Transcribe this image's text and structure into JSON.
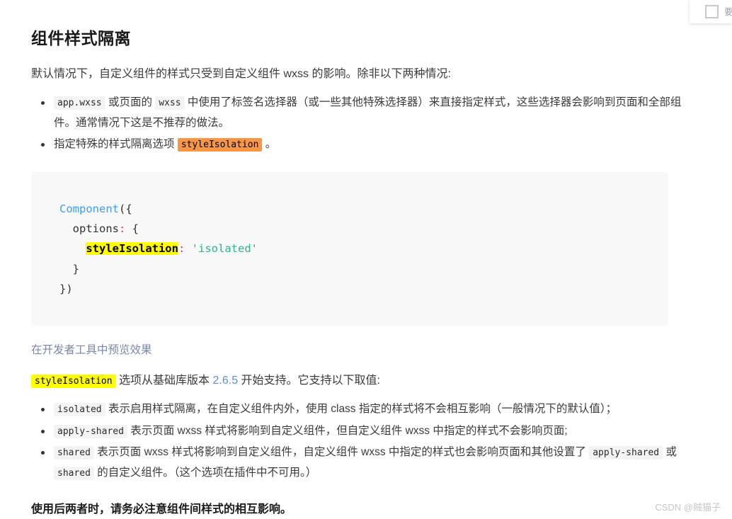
{
  "corner_panel": {
    "checkbox_checked": false,
    "partial_text": "要"
  },
  "article": {
    "title": "组件样式隔离",
    "intro": "默认情况下，自定义组件的样式只受到自定义组件 wxss 的影响。除非以下两种情况:",
    "bullets_top": [
      {
        "code1": "app.wxss",
        "text1": "或页面的",
        "code2": "wxss",
        "text2": "中使用了标签名选择器（或一些其他特殊选择器）来直接指定样式，这些选择器会影响到页面和全部组件。通常情况下这是不推荐的做法。"
      },
      {
        "text1": "指定特殊的样式隔离选项",
        "code_highlight": "styleIsolation",
        "text2": "。"
      }
    ],
    "code_block": {
      "line1_fn": "Component",
      "line1_rest": "({",
      "line2_key": "  options",
      "line2_punc": ":",
      "line2_rest": " {",
      "line3_indent": "    ",
      "line3_hl": "styleIsolation",
      "line3_punc": ":",
      "line3_space": " ",
      "line3_str": "'isolated'",
      "line4": "  }",
      "line5": "})"
    },
    "preview_link": "在开发者工具中预览效果",
    "note": {
      "code": "styleIsolation",
      "text1": "选项从基础库版本",
      "version": "2.6.5",
      "text2": "开始支持。它支持以下取值:"
    },
    "bullets_values": [
      {
        "code": "isolated",
        "text": "表示启用样式隔离，在自定义组件内外，使用 class 指定的样式将不会相互影响（一般情况下的默认值）；"
      },
      {
        "code": "apply-shared",
        "text": "表示页面 wxss 样式将影响到自定义组件，但自定义组件 wxss 中指定的样式不会影响页面;"
      },
      {
        "code": "shared",
        "text_a": "表示页面 wxss 样式将影响到自定义组件，自定义组件 wxss 中指定的样式也会影响页面和其他设置了",
        "code_b": "apply-shared",
        "text_b": "或",
        "code_c": "shared",
        "text_c": "的自定义组件。（这个选项在插件中不可用。）"
      }
    ],
    "warning": "使用后两者时，请务必注意组件间样式的相互影响。"
  },
  "watermark": "CSDN @贼猫子",
  "colors": {
    "accent_orange": "#f79646",
    "accent_yellow": "#ffff00",
    "code_fn": "#3b9eff",
    "code_string": "#2db587",
    "code_punct": "#e8384f",
    "link": "#7a86a8",
    "version_link": "#5b8fd8",
    "codeblock_bg": "#f8f8f8"
  }
}
